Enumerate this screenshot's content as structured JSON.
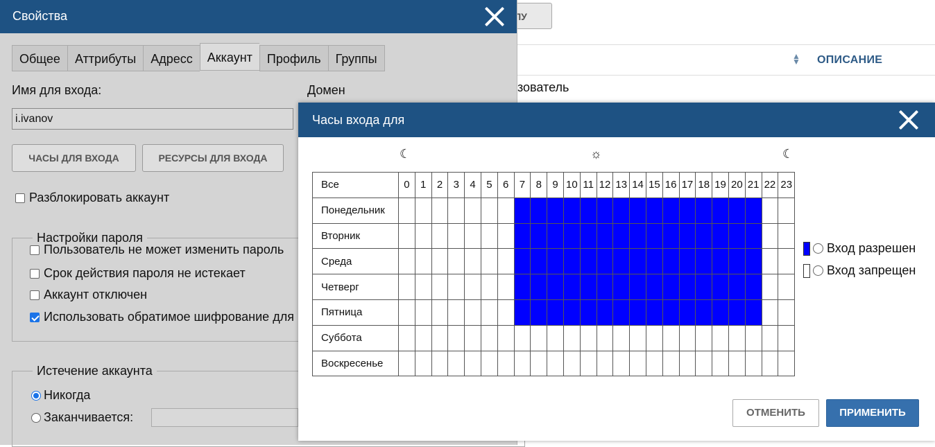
{
  "background": {
    "top_button_label": "ППУ",
    "column_description": "ОПИСАНИЕ",
    "row_text": "зователь"
  },
  "properties": {
    "title": "Свойства",
    "tabs": [
      {
        "label": "Общее"
      },
      {
        "label": "Аттрибуты"
      },
      {
        "label": "Адресс"
      },
      {
        "label": "Аккаунт",
        "active": true
      },
      {
        "label": "Профиль"
      },
      {
        "label": "Группы"
      }
    ],
    "login_label": "Имя для входа:",
    "login_value": "i.ivanov",
    "domain_label": "Домен",
    "logon_hours_button": "ЧАСЫ ДЛЯ ВХОДА",
    "logon_resources_button": "РЕСУРСЫ ДЛЯ ВХОДА",
    "unlock_label": "Разблокировать аккаунт",
    "password_settings": {
      "legend": "Настройки пароля",
      "options": [
        {
          "label": "Пользователь не может изменить пароль",
          "checked": false
        },
        {
          "label": "Срок действия пароля не истекает",
          "checked": false
        },
        {
          "label": "Аккаунт отключен",
          "checked": false
        },
        {
          "label": "Использовать обратимое шифрование для",
          "checked": true
        }
      ]
    },
    "expiration": {
      "legend": "Истечение аккаунта",
      "never_label": "Никогда",
      "expires_label": "Заканчивается:",
      "selected": "never"
    }
  },
  "logon_hours": {
    "title": "Часы входа для",
    "all_label": "Все",
    "hours": [
      "0",
      "1",
      "2",
      "3",
      "4",
      "5",
      "6",
      "7",
      "8",
      "9",
      "10",
      "11",
      "12",
      "13",
      "14",
      "15",
      "16",
      "17",
      "18",
      "19",
      "20",
      "21",
      "22",
      "23"
    ],
    "time_icons": [
      "moon-icon",
      "sun-icon",
      "moon-icon"
    ],
    "days": [
      {
        "name": "Понедельник",
        "allowed": [
          7,
          21
        ]
      },
      {
        "name": "Вторник",
        "allowed": [
          7,
          21
        ]
      },
      {
        "name": "Среда",
        "allowed": [
          7,
          21
        ]
      },
      {
        "name": "Четверг",
        "allowed": [
          7,
          21
        ]
      },
      {
        "name": "Пятница",
        "allowed": [
          7,
          21
        ]
      },
      {
        "name": "Суббота",
        "allowed": null
      },
      {
        "name": "Воскресенье",
        "allowed": null
      }
    ],
    "legend_allowed": "Вход разрешен",
    "legend_denied": "Вход запрещен",
    "allowed_color": "#0000ff",
    "denied_color": "#ffffff",
    "cancel_label": "ОТМЕНИТЬ",
    "apply_label": "ПРИМЕНИТЬ"
  }
}
